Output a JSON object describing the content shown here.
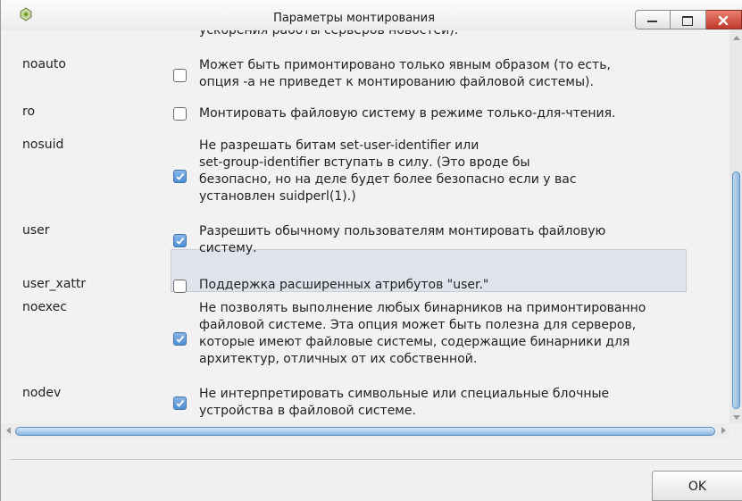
{
  "window": {
    "title": "Параметры монтирования",
    "app_icon": "drive-icon"
  },
  "colors": {
    "checkbox_checked": "#4f8dd3",
    "scrollbar_thumb": "#8fb7df",
    "row_highlight": "#dfe4ec"
  },
  "cut_line": "ускорения работы серверов новостей).",
  "options": [
    {
      "name": "noauto",
      "checked": false,
      "desc": "Может быть примонтировано только явным образом (то есть,\nопция -a не приведет к монтированию файловой системы)."
    },
    {
      "name": "ro",
      "checked": false,
      "desc": "Монтировать файловую систему в режиме только-для-чтения."
    },
    {
      "name": "nosuid",
      "checked": true,
      "desc": "Не разрешать битам set-user-identifier или\nset-group-identifier вступать в силу. (Это вроде бы\nбезопасно, но на деле будет более безопасно если у вас\nустановлен suidperl(1).)"
    },
    {
      "name": "user",
      "checked": true,
      "desc": "Разрешить обычному пользователям монтировать файловую\nсистему."
    },
    {
      "name": "user_xattr",
      "checked": false,
      "desc": "Поддержка расширенных атрибутов \"user.\""
    },
    {
      "name": "noexec",
      "checked": true,
      "desc": "Не позволять выполнение любых бинарников на примонтированно\nфайловой системе. Эта опция может быть полезна для серверов,\nкоторые имеют файловые системы, содержащие бинарники для\nархитектур, отличных от их собственной."
    },
    {
      "name": "nodev",
      "checked": true,
      "desc": "Не интерпретировать символьные или специальные блочные\nустройства в файловой системе."
    }
  ],
  "buttons": {
    "ok": "OK"
  }
}
